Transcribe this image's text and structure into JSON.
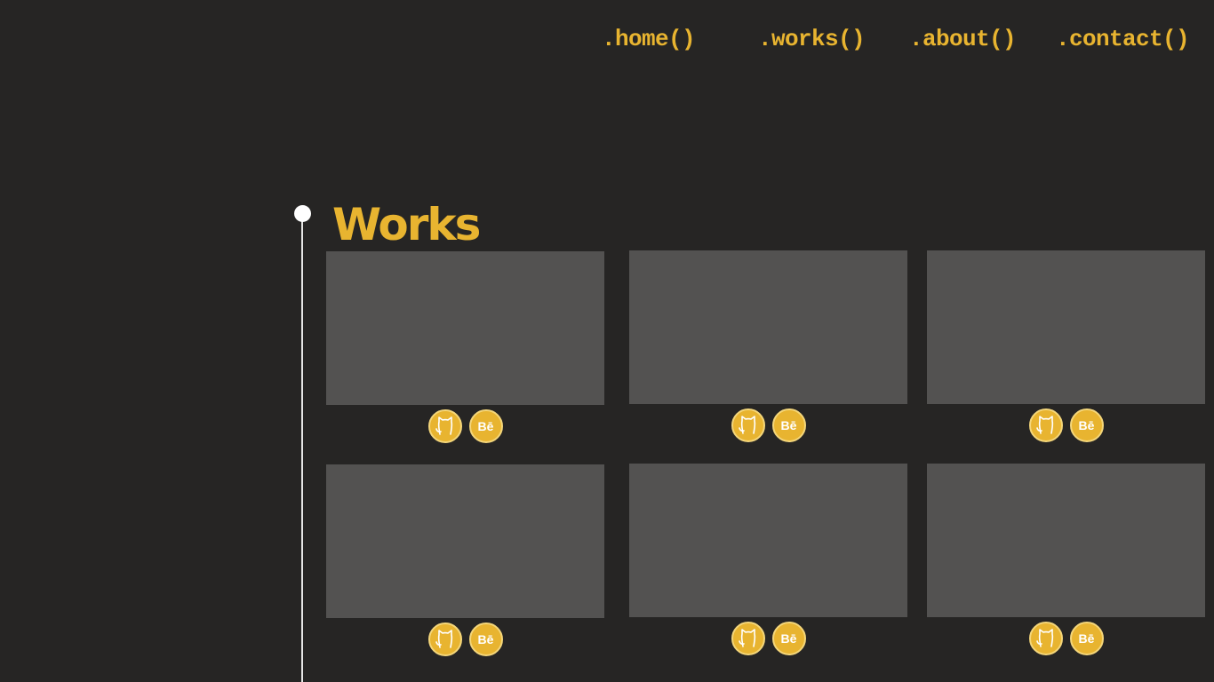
{
  "nav": {
    "items": [
      {
        "label": ".home()"
      },
      {
        "label": ".works()"
      },
      {
        "label": ".about()"
      },
      {
        "label": ".contact()"
      }
    ]
  },
  "section": {
    "title": "Works"
  },
  "works": {
    "items": [
      {
        "github_icon": "github-icon",
        "behance_label": "Bē"
      },
      {
        "github_icon": "github-icon",
        "behance_label": "Bē"
      },
      {
        "github_icon": "github-icon",
        "behance_label": "Bē"
      },
      {
        "github_icon": "github-icon",
        "behance_label": "Bē"
      },
      {
        "github_icon": "github-icon",
        "behance_label": "Bē"
      },
      {
        "github_icon": "github-icon",
        "behance_label": "Bē"
      }
    ]
  },
  "colors": {
    "background": "#262524",
    "accent": "#e8b430",
    "thumbnail": "#535251",
    "timeline": "#ffffff"
  }
}
